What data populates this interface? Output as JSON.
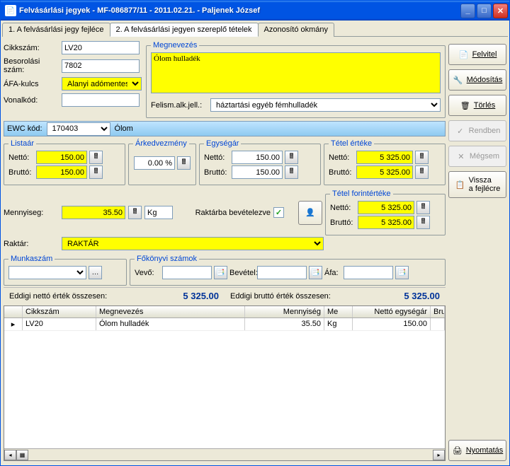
{
  "title": "Felvásárlási jegyek  -  MF-086877/11  -  2011.02.21.  -  Paljenek József",
  "tabs": [
    "1. A felvásárlási jegy fejléce",
    "2. A felvásárlási jegyen szereplő tételek",
    "Azonosító okmány"
  ],
  "labels": {
    "cikkszam": "Cikkszám:",
    "besorolasi": "Besorolási szám:",
    "afa": "ÁFA-kulcs",
    "vonalkod": "Vonalkód:",
    "ewc": "EWC kód:",
    "mennyiseg": "Mennyiseg:",
    "raktar": "Raktár:",
    "raktarba": "Raktárba bevételezve",
    "netto": "Nettó:",
    "brutto": "Bruttó:",
    "felism": "Felism.alk.jell.:",
    "vevo": "Vevő:",
    "bevetel": "Bevétel:",
    "afa2": "Áfa:",
    "eddnetto": "Eddigi nettó érték összesen:",
    "eddbrutto": "Eddigi bruttó érték összesen:"
  },
  "legends": {
    "megnevezes": "Megnevezés",
    "listaar": "Listaár",
    "arkedv": "Árkedvezmény",
    "egysegar": "Egységár",
    "tetelerteke": "Tétel értéke",
    "tetelforint": "Tétel forintértéke",
    "munkaszam": "Munkaszám",
    "fokonyvi": "Főkönyvi számok"
  },
  "values": {
    "cikkszam": "LV20",
    "besorolasi": "7802",
    "afa": "Alanyi adómentes",
    "vonalkod": "",
    "megnevezes": "Ólom hulladék",
    "felism": "háztartási egyéb fémhulladék",
    "ewc": "170403",
    "ewcname": "Ólom",
    "listaar_netto": "150.00",
    "listaar_brutto": "150.00",
    "arkedv": "0.00 %",
    "egysegar_netto": "150.00",
    "egysegar_brutto": "150.00",
    "tetel_netto": "5 325.00",
    "tetel_brutto": "5 325.00",
    "mennyiseg": "35.50",
    "unit": "Kg",
    "raktar": "RAKTÁR",
    "forint_netto": "5 325.00",
    "forint_brutto": "5 325.00",
    "total_netto": "5 325.00",
    "total_brutto": "5 325.00"
  },
  "buttons": {
    "felvitel": "Felvitel",
    "modositas": "Módosítás",
    "torles": "Törlés",
    "rendben": "Rendben",
    "megsem": "Mégsem",
    "vissza1": "Vissza",
    "vissza2": "a fejlécre",
    "nyomtatas": "Nyomtatás"
  },
  "grid": {
    "headers": [
      "",
      "Cikkszám",
      "Megnevezés",
      "Mennyiség",
      "Me",
      "Nettó egységár",
      "Bruttó egy"
    ],
    "rows": [
      {
        "cikkszam": "LV20",
        "megnevezes": "Ólom hulladék",
        "mennyiseg": "35.50",
        "me": "Kg",
        "netto": "150.00",
        "brutto": ""
      }
    ]
  }
}
